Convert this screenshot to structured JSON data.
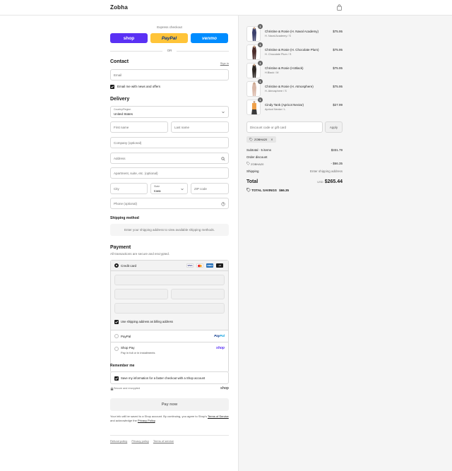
{
  "header": {
    "brand": "Zobha"
  },
  "express": {
    "label": "Express checkout",
    "shop": "shop",
    "paypal": "PayPal",
    "venmo": "venmo",
    "or": "OR"
  },
  "contact": {
    "title": "Contact",
    "sign_in": "Sign in",
    "email_placeholder": "Email",
    "news_label": "Email me with news and offers"
  },
  "delivery": {
    "title": "Delivery",
    "country_label": "Country/Region",
    "country_value": "United States",
    "first_name": "First name",
    "last_name": "Last name",
    "company": "Company (optional)",
    "address": "Address",
    "apartment": "Apartment, suite, etc. (optional)",
    "city": "City",
    "state_label": "State",
    "state_value": "Iowa",
    "zip": "ZIP code",
    "phone": "Phone (optional)"
  },
  "shipping_method": {
    "title": "Shipping method",
    "note": "Enter your shipping address to view available shipping methods."
  },
  "payment": {
    "title": "Payment",
    "subtitle": "All transactions are secure and encrypted.",
    "credit_card": "Credit card",
    "more_cards": "+3",
    "billing_same": "Use shipping address as billing address",
    "paypal": "PayPal",
    "shop_pay": "Shop Pay",
    "shop_pay_sub": "Pay in full or in installments",
    "shop_logo": "shop"
  },
  "remember": {
    "title": "Remember me",
    "save_label": "Save my information for a faster checkout with a Shop account",
    "secure": "Secure and encrypted",
    "shop_logo": "shop"
  },
  "pay_now": "Pay now",
  "legal": {
    "text": "Your info will be saved to a Shop account. By continuing, you agree to Shop's",
    "tos": "Terms of Service",
    "and": "and acknowledge the",
    "privacy": "Privacy Policy",
    "period": "."
  },
  "footer_links": [
    "Refund policy",
    "Privacy policy",
    "Terms of service"
  ],
  "items": [
    {
      "name": "Christine & Rosie (H. Naval Academy)",
      "variant": "H. Naval Academy / S",
      "price": "$75.95",
      "qty": "1",
      "color": "#3b3f6b"
    },
    {
      "name": "Christine & Rosie (H. Chocolate Plum)",
      "variant": "H. Chocolate Plum / S",
      "price": "$75.95",
      "qty": "1",
      "color": "#4a2c2a"
    },
    {
      "name": "Christine & Rosie (H.Black)",
      "variant": "H.Black / M",
      "price": "$75.95",
      "qty": "1",
      "color": "#2a2420"
    },
    {
      "name": "Christine & Rosie (H. Atmosphere)",
      "variant": "H. Atmosphere / S",
      "price": "$75.95",
      "qty": "1",
      "color": "#d9b8a8"
    },
    {
      "name": "Cindy Tank (Apricot Nectar)",
      "variant": "Apricot Nectar / L",
      "price": "$27.99",
      "qty": "1",
      "color": "#f0a14a"
    }
  ],
  "discount": {
    "placeholder": "Discount code or gift card",
    "apply": "Apply",
    "code": "ZOBHA20"
  },
  "summary": {
    "subtotal_label": "Subtotal · 5 items",
    "subtotal": "$331.79",
    "order_discount": "Order discount",
    "code": "ZOBHA20",
    "discount_value": "- $66.35",
    "shipping_label": "Shipping",
    "shipping_value": "Enter shipping address",
    "total_label": "Total",
    "currency": "USD",
    "total": "$265.44",
    "savings_label": "TOTAL SAVINGS",
    "savings": "$66.35"
  }
}
